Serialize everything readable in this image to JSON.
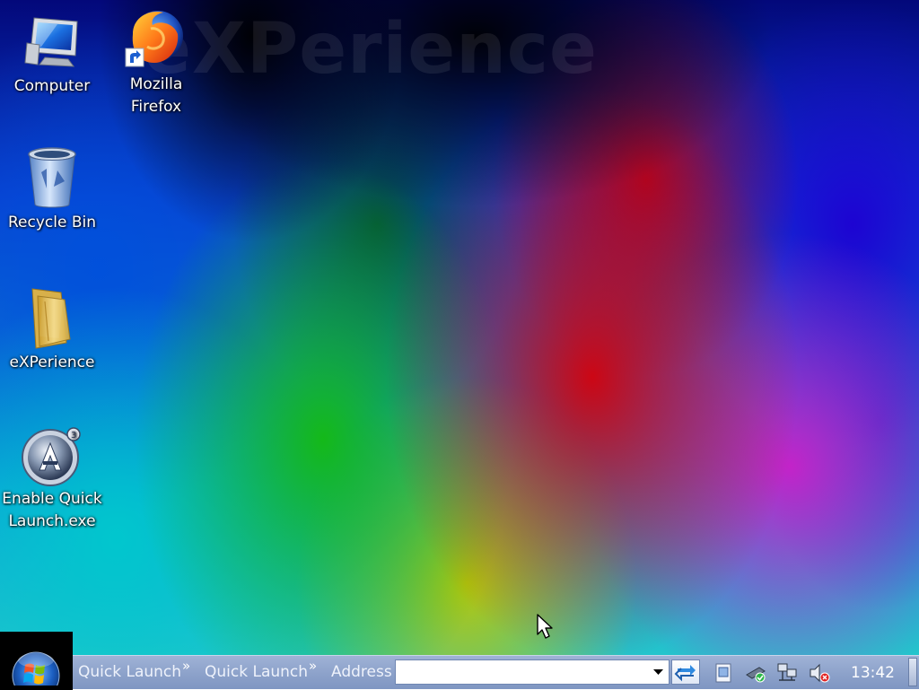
{
  "desktop": {
    "watermark": "eXPerience",
    "icons": [
      {
        "label": "Computer",
        "icon": "computer-icon"
      },
      {
        "label": "Mozilla\nFirefox",
        "icon": "firefox-icon"
      },
      {
        "label": "Recycle Bin",
        "icon": "recycle-bin-icon"
      },
      {
        "label": "eXPerience",
        "icon": "folder-icon"
      },
      {
        "label": "Enable Quick\nLaunch.exe",
        "icon": "quick-launch-exe-icon"
      }
    ]
  },
  "taskbar": {
    "start_icon": "windows-orb-icon",
    "toolbars": [
      {
        "label": "Quick Launch"
      },
      {
        "label": "Quick Launch"
      },
      {
        "label": "Address"
      }
    ],
    "address": {
      "value": "",
      "placeholder": ""
    },
    "tray_icons": [
      "document-icon",
      "network-status-icon",
      "network-connection-icon",
      "volume-muted-icon"
    ],
    "clock": "13:42"
  },
  "colors": {
    "taskbar": "#8ea3cb",
    "start_area": "#000000",
    "desktop_text": "#ffffff"
  }
}
